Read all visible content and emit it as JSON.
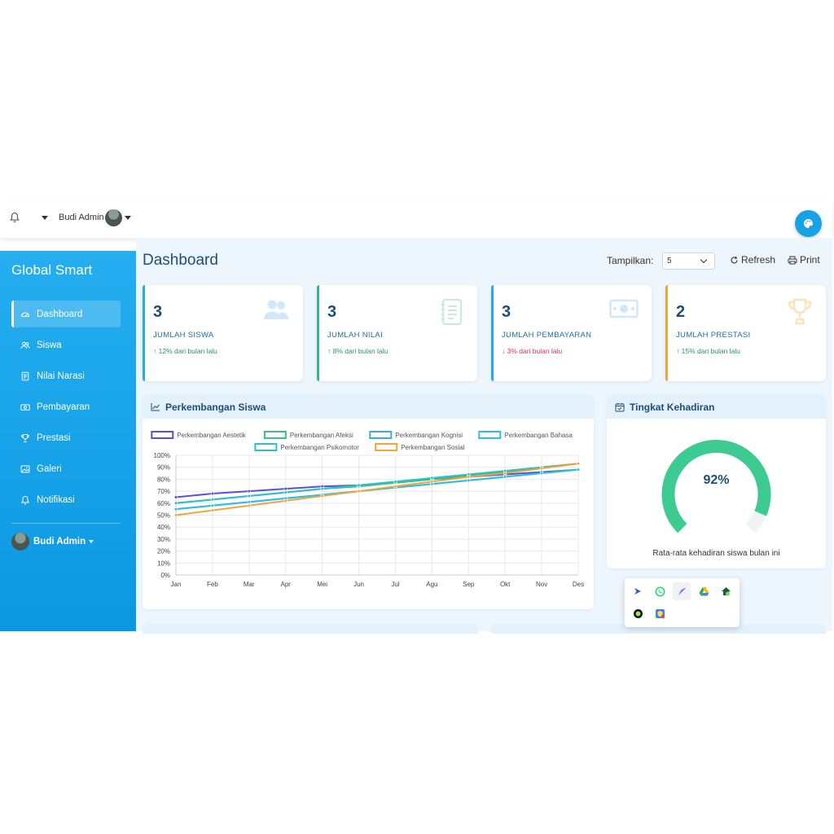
{
  "topbar": {
    "user_name": "Budi Admin"
  },
  "sidebar": {
    "brand": "Global Smart",
    "items": [
      {
        "label": "Dashboard",
        "icon": "dashboard-icon",
        "active": true
      },
      {
        "label": "Siswa",
        "icon": "users-icon"
      },
      {
        "label": "Nilai Narasi",
        "icon": "document-icon"
      },
      {
        "label": "Pembayaran",
        "icon": "money-icon"
      },
      {
        "label": "Prestasi",
        "icon": "trophy-icon"
      },
      {
        "label": "Galeri",
        "icon": "image-icon"
      },
      {
        "label": "Notifikasi",
        "icon": "bell-icon"
      }
    ],
    "user_name": "Budi Admin"
  },
  "header": {
    "title": "Dashboard",
    "tampilkan_label": "Tampilkan:",
    "tampilkan_value": "5",
    "refresh_label": "Refresh",
    "print_label": "Print"
  },
  "cards": [
    {
      "value": "3",
      "label": "JUMLAH SISWA",
      "trend": "↑ 12% dari bulan lalu",
      "direction": "up",
      "color": "#29a9e8"
    },
    {
      "value": "3",
      "label": "JUMLAH NILAI",
      "trend": "↑ 8% dari bulan lalu",
      "direction": "up",
      "color": "#34b88a"
    },
    {
      "value": "3",
      "label": "JUMLAH PEMBAYARAN",
      "trend": "↓ 3% dari bulan lalu",
      "direction": "down",
      "color": "#29a9e8"
    },
    {
      "value": "2",
      "label": "JUMLAH PRESTASI",
      "trend": "↑ 15% dari bulan lalu",
      "direction": "up",
      "color": "#f0a43a"
    }
  ],
  "chart_panel": {
    "title": "Perkembangan Siswa"
  },
  "attendance_panel": {
    "title": "Tingkat Kehadiran",
    "value": "92%",
    "percent": 92,
    "caption": "Rata-rata kehadiran siswa bulan ini"
  },
  "chart_data": {
    "type": "line",
    "categories": [
      "Jan",
      "Feb",
      "Mar",
      "Apr",
      "Mei",
      "Jun",
      "Jul",
      "Agu",
      "Sep",
      "Okt",
      "Nov",
      "Des"
    ],
    "ylim": [
      0,
      100
    ],
    "yticks": [
      "0%",
      "10%",
      "20%",
      "30%",
      "40%",
      "50%",
      "60%",
      "70%",
      "80%",
      "90%",
      "100%"
    ],
    "grid": true,
    "legend_position": "top",
    "series": [
      {
        "name": "Perkembangan Aestetik",
        "color": "#5b4fd6",
        "values": [
          65,
          68,
          70,
          72,
          74,
          75,
          77,
          80,
          82,
          84,
          86,
          88
        ]
      },
      {
        "name": "Perkembangan Afeksi",
        "color": "#3bbf86",
        "values": [
          60,
          63,
          66,
          69,
          72,
          74,
          77,
          80,
          83,
          86,
          90,
          93
        ]
      },
      {
        "name": "Perkembangan Kognisi",
        "color": "#3aaed8",
        "values": [
          55,
          58,
          61,
          64,
          67,
          70,
          73,
          76,
          79,
          82,
          85,
          88
        ]
      },
      {
        "name": "Perkembangan Bahasa",
        "color": "#2dbfe0",
        "values": [
          55,
          58,
          61,
          64,
          67,
          70,
          73,
          76,
          79,
          82,
          85,
          88
        ]
      },
      {
        "name": "Perkembangan Psikomotor",
        "color": "#2fbfc4",
        "values": [
          60,
          63,
          66,
          69,
          72,
          75,
          78,
          81,
          84,
          87,
          90,
          93
        ]
      },
      {
        "name": "Perkembangan Sosial",
        "color": "#f0a43a",
        "values": [
          50,
          54,
          58,
          62,
          66,
          70,
          74,
          78,
          82,
          85,
          89,
          93
        ]
      }
    ]
  },
  "popup": {
    "icons": [
      "arrow-app-icon",
      "whatsapp-icon",
      "feather-icon",
      "drive-icon",
      "vpn-icon",
      "record-icon",
      "shield-app-icon"
    ]
  }
}
